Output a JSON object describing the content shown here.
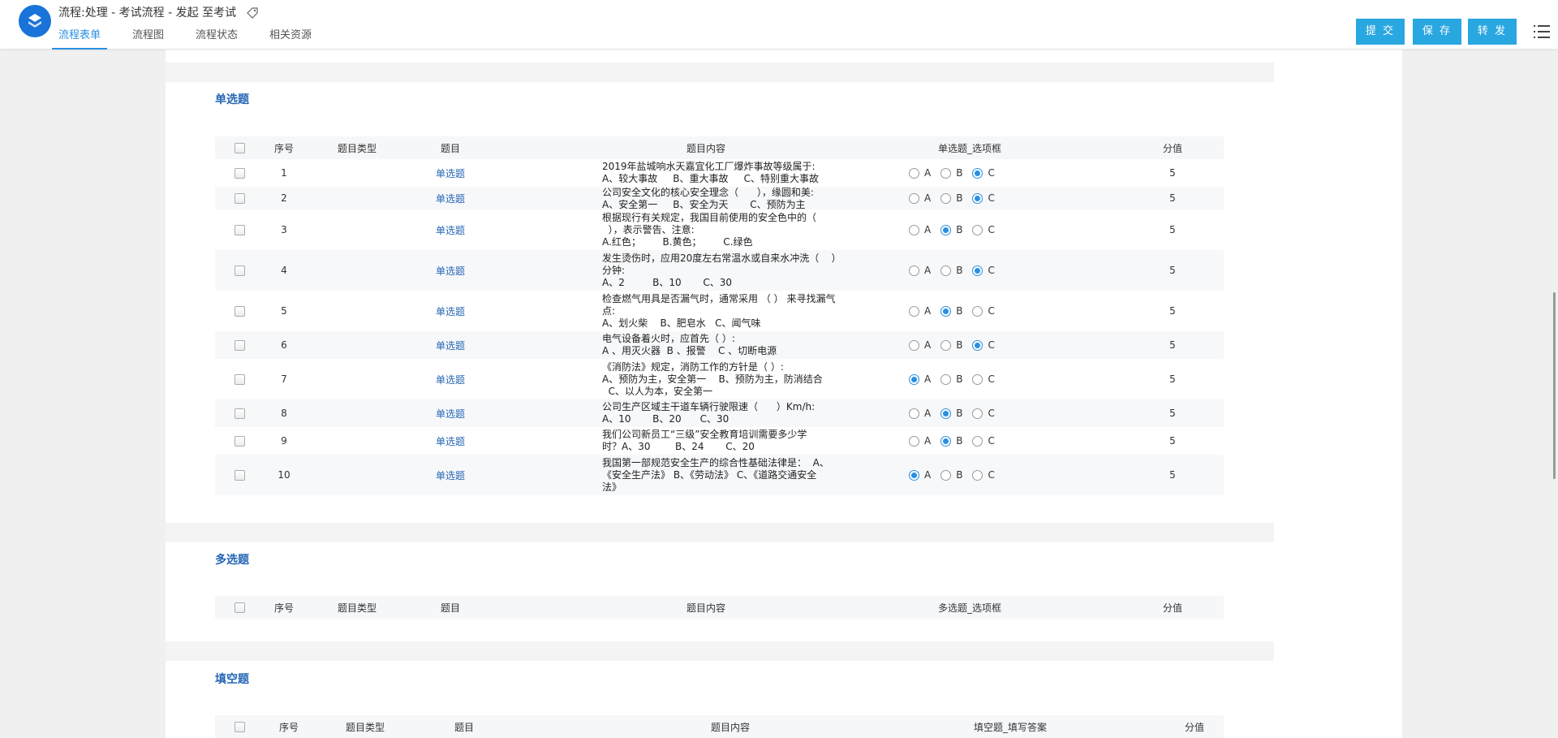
{
  "header": {
    "title": "流程:处理 - 考试流程 - 发起 至考试",
    "tabs": [
      "流程表单",
      "流程图",
      "流程状态",
      "相关资源"
    ],
    "buttons": {
      "submit": "提 交",
      "save": "保 存",
      "forward": "转 发"
    }
  },
  "single": {
    "title": "单选题",
    "headers": {
      "no": "序号",
      "type": "题目类型",
      "subject": "题目",
      "content": "题目内容",
      "options": "单选题_选项框",
      "score": "分值"
    },
    "rows": [
      {
        "no": "1",
        "subject": "单选题",
        "content": "2019年盐城响水天嘉宜化工厂爆炸事故等级属于:\nA、较大事故     B、重大事故     C、特别重大事故",
        "selected": "C",
        "score": "5"
      },
      {
        "no": "2",
        "subject": "单选题",
        "content": "公司安全文化的核心安全理念（      ），缘圆和美:\nA、安全第一     B、安全为天       C、预防为主",
        "selected": "C",
        "score": "5"
      },
      {
        "no": "3",
        "subject": "单选题",
        "content": "根据现行有关规定，我国目前使用的安全色中的（\n  ），表示警告、注意:\nA.红色；       B.黄色；       C.绿色",
        "selected": "B",
        "score": "5"
      },
      {
        "no": "4",
        "subject": "单选题",
        "content": "发生烫伤时，应用20度左右常温水或自来水冲洗（    ）\n分钟:\nA、2         B、10       C、30",
        "selected": "C",
        "score": "5"
      },
      {
        "no": "5",
        "subject": "单选题",
        "content": "检查燃气用具是否漏气时，通常采用 （ ） 来寻找漏气\n点:\nA、划火柴    B、肥皂水   C、闻气味",
        "selected": "B",
        "score": "5"
      },
      {
        "no": "6",
        "subject": "单选题",
        "content": "电气设备着火时，应首先（ ）:\nA 、用灭火器  B 、报警    C 、切断电源",
        "selected": "C",
        "score": "5"
      },
      {
        "no": "7",
        "subject": "单选题",
        "content": "《消防法》规定，消防工作的方针是（ ）:\nA、预防为主，安全第一    B、预防为主，防消结合\n  C、以人为本，安全第一",
        "selected": "A",
        "score": "5"
      },
      {
        "no": "8",
        "subject": "单选题",
        "content": "公司生产区域主干道车辆行驶限速（      ）Km/h:\nA、10       B、20      C、30",
        "selected": "B",
        "score": "5"
      },
      {
        "no": "9",
        "subject": "单选题",
        "content": "我们公司新员工“三级”安全教育培训需要多少学\n时？A、30        B、24       C、20",
        "selected": "B",
        "score": "5"
      },
      {
        "no": "10",
        "subject": "单选题",
        "content": "我国第一部规范安全生产的综合性基础法律是：  A、\n《安全生产法》 B、《劳动法》 C、《道路交通安全\n法》",
        "selected": "A",
        "score": "5"
      }
    ]
  },
  "multi": {
    "title": "多选题",
    "headers": {
      "no": "序号",
      "type": "题目类型",
      "subject": "题目",
      "content": "题目内容",
      "options": "多选题_选项框",
      "score": "分值"
    }
  },
  "fill": {
    "title": "填空题",
    "headers": {
      "no": "序号",
      "type": "题目类型",
      "subject": "题目",
      "content": "题目内容",
      "options": "填空题_填写答案",
      "score": "分值"
    }
  },
  "option_labels": [
    "A",
    "B",
    "C"
  ],
  "colors": {
    "accent": "#2b8fe0",
    "button": "#29a7e1",
    "section_title": "#2466b4"
  }
}
